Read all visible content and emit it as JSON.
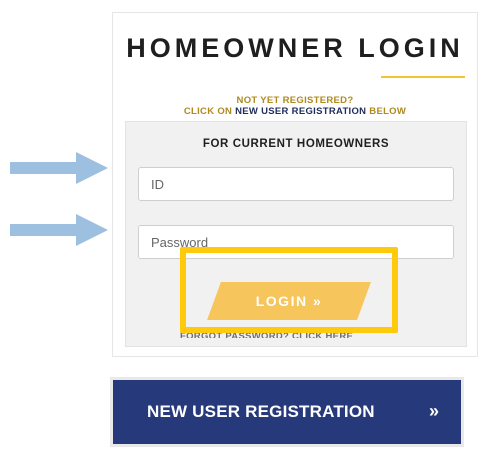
{
  "title": "HOMEOWNER LOGIN",
  "registration_note": {
    "line1": "NOT YET REGISTERED?",
    "line2_prefix": "CLICK ON ",
    "line2_emphasis": "NEW USER REGISTRATION",
    "line2_suffix": " BELOW"
  },
  "panel": {
    "heading": "FOR CURRENT HOMEOWNERS",
    "id_placeholder": "ID",
    "password_placeholder": "Password",
    "login_label": "LOGIN »",
    "forgot_text": "FORGOT PASSWORD? CLICK HERE"
  },
  "new_user_button": {
    "label": "NEW USER REGISTRATION",
    "chevron": "»"
  },
  "colors": {
    "accent_yellow": "#f6c55b",
    "highlight_yellow": "#ffc90e",
    "navy": "#26397a",
    "arrow_blue": "#9dbfe0"
  },
  "annotations": {
    "arrow_icon": "right-arrow-icon",
    "highlight": "login-highlight-box"
  }
}
